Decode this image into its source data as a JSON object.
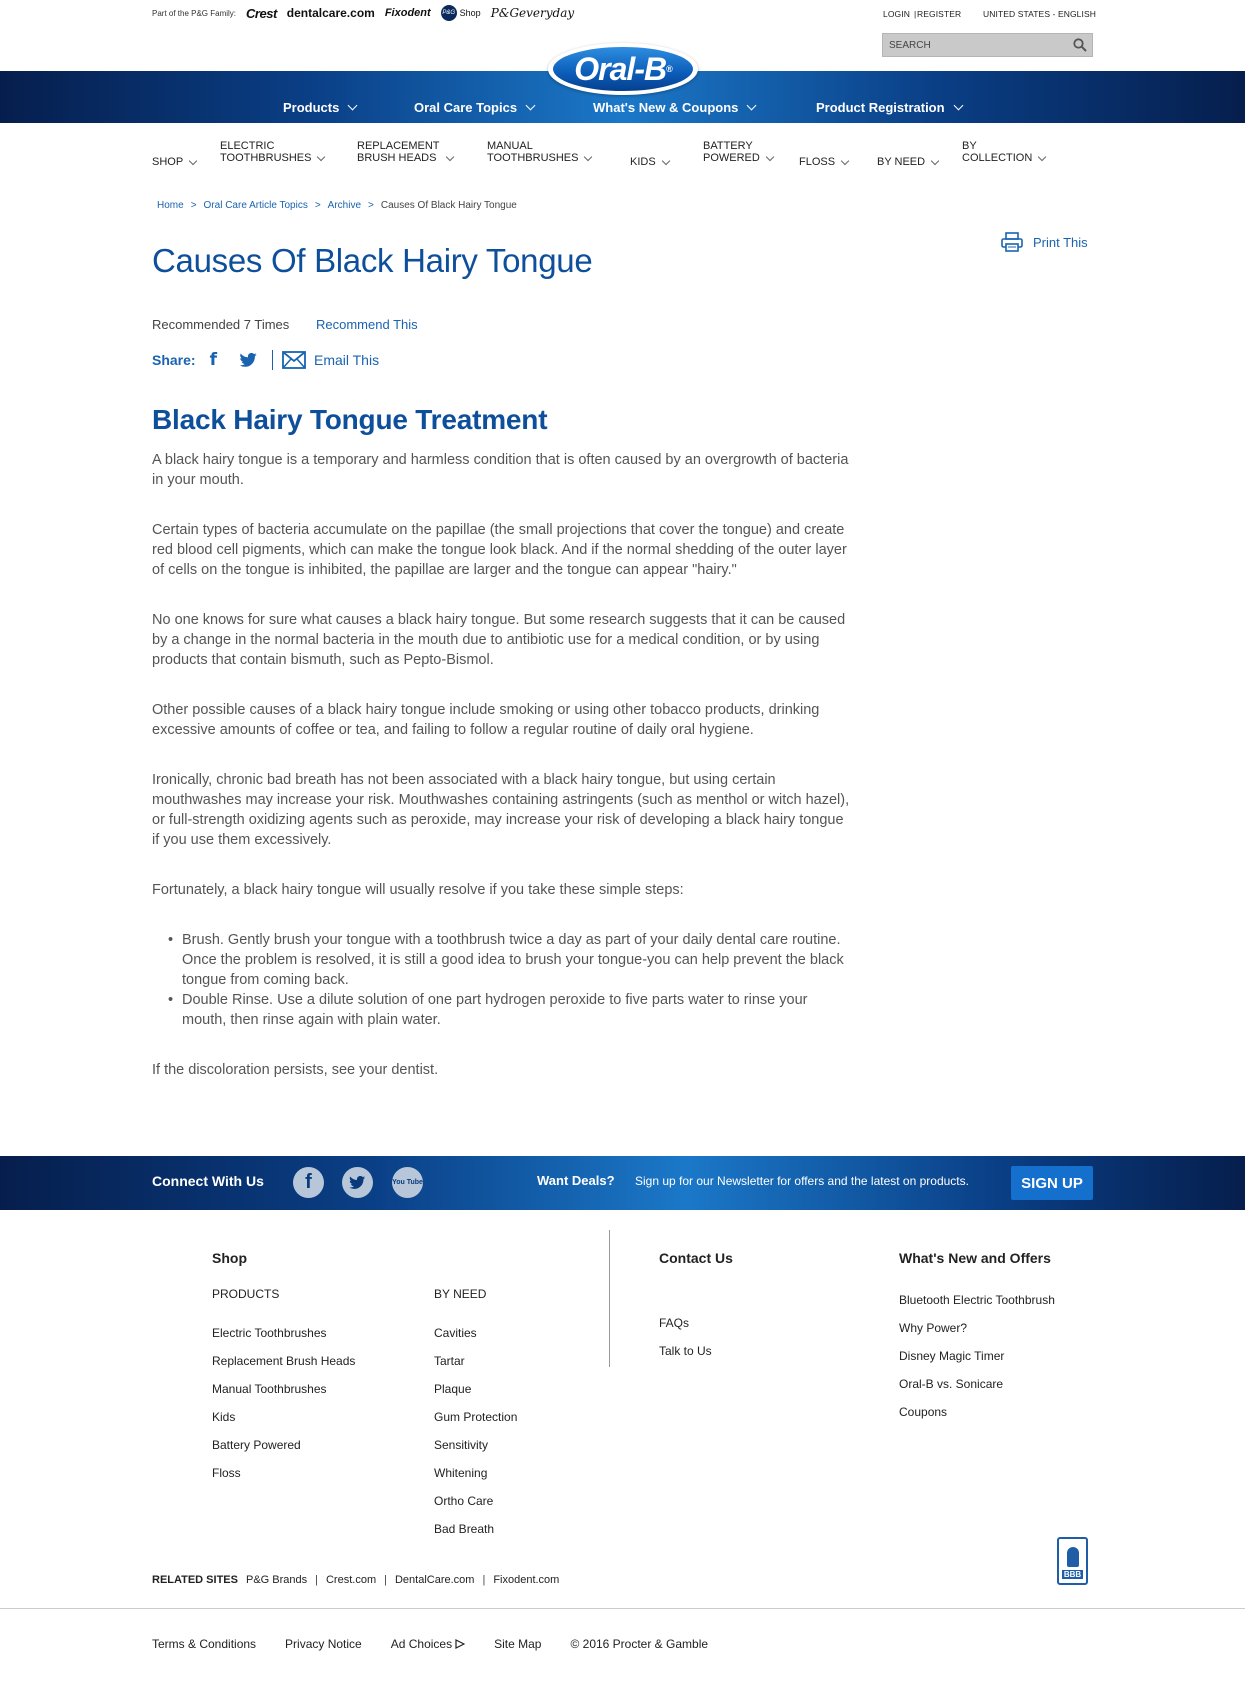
{
  "family": {
    "prefix": "Part of the P&G Family:",
    "brands": [
      "Crest",
      "dentalcare.com",
      "Fixodent",
      "Shop",
      "P&Geveryday"
    ],
    "pg_badge": "P&G"
  },
  "top": {
    "login": "LOGIN",
    "register": "REGISTER",
    "locale": "UNITED STATES - ENGLISH",
    "search_placeholder": "SEARCH"
  },
  "logo": {
    "text": "Oral-B",
    "reg": "®"
  },
  "main_nav": [
    "Products",
    "Oral Care Topics",
    "What's New & Coupons",
    "Product Registration"
  ],
  "sub_nav": [
    [
      "SHOP"
    ],
    [
      "ELECTRIC",
      "TOOTHBRUSHES"
    ],
    [
      "REPLACEMENT",
      "BRUSH HEADS"
    ],
    [
      "MANUAL",
      "TOOTHBRUSHES"
    ],
    [
      "KIDS"
    ],
    [
      "BATTERY",
      "POWERED"
    ],
    [
      "FLOSS"
    ],
    [
      "BY NEED"
    ],
    [
      "BY",
      "COLLECTION"
    ]
  ],
  "breadcrumb": [
    "Home",
    "Oral Care Article Topics",
    "Archive",
    "Causes Of Black Hairy Tongue"
  ],
  "breadcrumb_sep": ">",
  "print_label": "Print This",
  "title": "Causes Of Black Hairy Tongue",
  "recommended": "Recommended 7 Times",
  "recommend_link": "Recommend This",
  "share": {
    "label": "Share:",
    "email": "Email This",
    "facebook_glyph": "f"
  },
  "article": {
    "heading": "Black Hairy Tongue Treatment",
    "paragraphs": [
      "A black hairy tongue is a temporary and harmless condition that is often caused by an overgrowth of bacteria in your mouth.",
      "Certain types of bacteria accumulate on the papillae (the small projections that cover the tongue) and create red blood cell pigments, which can make the tongue look black. And if the normal shedding of the outer layer of cells on the tongue is inhibited, the papillae are larger and the tongue can appear \"hairy.\"",
      "No one knows for sure what causes a black hairy tongue. But some research suggests that it can be caused by a change in the normal bacteria in the mouth due to antibiotic use for a medical condition, or by using products that contain bismuth, such as Pepto-Bismol.",
      "Other possible causes of a black hairy tongue include smoking or using other tobacco products, drinking excessive amounts of coffee or tea, and failing to follow a regular routine of daily oral hygiene.",
      "Ironically, chronic bad breath has not been associated with a black hairy tongue, but using certain mouthwashes may increase your risk. Mouthwashes containing astringents (such as menthol or witch hazel), or full-strength oxidizing agents such as peroxide, may increase your risk of developing a black hairy tongue if you use them excessively.",
      "Fortunately, a black hairy tongue will usually resolve if you take these simple steps:"
    ],
    "bullets": [
      "Brush. Gently brush your tongue with a toothbrush twice a day as part of your daily dental care routine. Once the problem is resolved, it is still a good idea to brush your tongue-you can help prevent the black tongue from coming back.",
      "Double Rinse. Use a dilute solution of one part hydrogen peroxide to five parts water to rinse your mouth, then rinse again with plain water."
    ],
    "closing": "If the discoloration persists, see your dentist."
  },
  "footer_band": {
    "connect": "Connect With Us",
    "facebook_glyph": "f",
    "youtube_glyph": "You Tube",
    "deals": "Want Deals?",
    "newsletter": "Sign up for our Newsletter for offers and the latest on products.",
    "signup": "SIGN UP"
  },
  "footer": {
    "shop_heading": "Shop",
    "products_heading": "PRODUCTS",
    "products": [
      "Electric Toothbrushes",
      "Replacement Brush Heads",
      "Manual Toothbrushes",
      "Kids",
      "Battery Powered",
      "Floss"
    ],
    "byneed_heading": "BY NEED",
    "byneed": [
      "Cavities",
      "Tartar",
      "Plaque",
      "Gum Protection",
      "Sensitivity",
      "Whitening",
      "Ortho Care",
      "Bad Breath"
    ],
    "contact_heading": "Contact Us",
    "contact": [
      "FAQs",
      "Talk to Us"
    ],
    "whatsnew_heading": "What's New and Offers",
    "whatsnew": [
      "Bluetooth Electric Toothbrush",
      "Why Power?",
      "Disney Magic Timer",
      "Oral-B vs. Sonicare",
      "Coupons"
    ]
  },
  "related": {
    "label": "RELATED SITES",
    "sites": [
      "P&G Brands",
      "Crest.com",
      "DentalCare.com",
      "Fixodent.com"
    ]
  },
  "bbb_label": "BBB",
  "bottom_links": [
    "Terms & Conditions",
    "Privacy Notice",
    "Ad Choices",
    "Site Map",
    "© 2016 Procter & Gamble"
  ],
  "colors": {
    "brand_blue": "#0e4f9c",
    "link_blue": "#1a63b0",
    "header_dark": "#061e4d",
    "button_blue": "#1470cc"
  }
}
